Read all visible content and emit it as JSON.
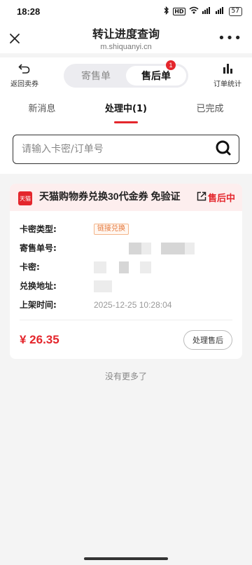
{
  "status_bar": {
    "time": "18:28",
    "hd_label": "HD",
    "signal_label_1": "5G",
    "signal_label_2": "5G",
    "battery": "57"
  },
  "nav": {
    "title": "转让进度查询",
    "url": "m.shiquanyi.cn",
    "more": "•••"
  },
  "toolbar": {
    "back_label": "返回卖券",
    "segments": [
      {
        "label": "寄售单"
      },
      {
        "label": "售后单"
      }
    ],
    "active_segment_badge": "1",
    "stats_label": "订单统计"
  },
  "tabs": [
    {
      "label": "新消息"
    },
    {
      "label": "处理中(1)"
    },
    {
      "label": "已完成"
    }
  ],
  "search": {
    "placeholder": "请输入卡密/订单号"
  },
  "order": {
    "logo_text": "天猫",
    "title": "天猫购物券兑换30代金券 免验证",
    "status": "售后中",
    "rows": {
      "card_type_label": "卡密类型:",
      "card_type_value": "链接兑换",
      "order_no_label": "寄售单号:",
      "card_secret_label": "卡密:",
      "redeem_url_label": "兑换地址:",
      "listed_time_label": "上架时间:",
      "listed_time_value": "2025-12-25 10:28:04"
    },
    "price": "¥ 26.35",
    "action": "处理售后"
  },
  "footer_note": "没有更多了",
  "colors": {
    "accent": "#e4262c",
    "tag": "#e5773a",
    "header_bg": "#fdeeee"
  }
}
